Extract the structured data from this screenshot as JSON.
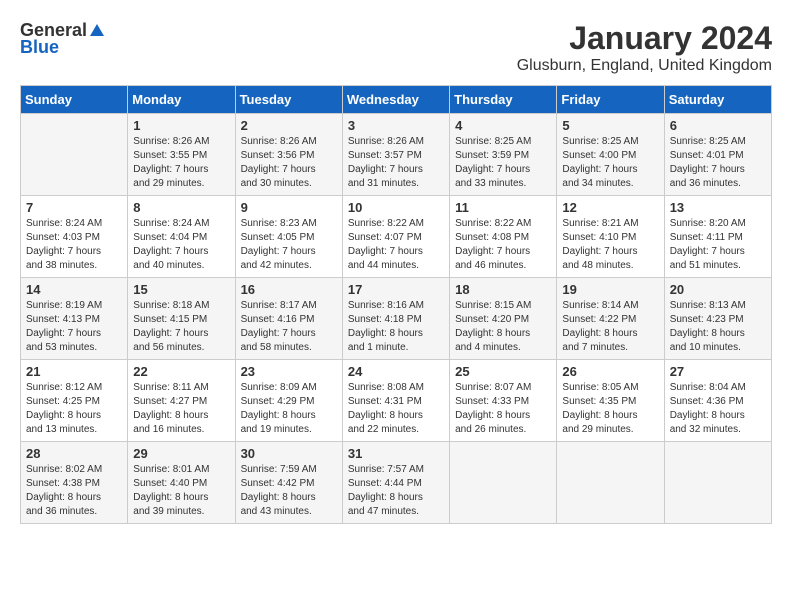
{
  "logo": {
    "general": "General",
    "blue": "Blue"
  },
  "title": "January 2024",
  "subtitle": "Glusburn, England, United Kingdom",
  "days_header": [
    "Sunday",
    "Monday",
    "Tuesday",
    "Wednesday",
    "Thursday",
    "Friday",
    "Saturday"
  ],
  "weeks": [
    [
      {
        "day": "",
        "info": ""
      },
      {
        "day": "1",
        "info": "Sunrise: 8:26 AM\nSunset: 3:55 PM\nDaylight: 7 hours\nand 29 minutes."
      },
      {
        "day": "2",
        "info": "Sunrise: 8:26 AM\nSunset: 3:56 PM\nDaylight: 7 hours\nand 30 minutes."
      },
      {
        "day": "3",
        "info": "Sunrise: 8:26 AM\nSunset: 3:57 PM\nDaylight: 7 hours\nand 31 minutes."
      },
      {
        "day": "4",
        "info": "Sunrise: 8:25 AM\nSunset: 3:59 PM\nDaylight: 7 hours\nand 33 minutes."
      },
      {
        "day": "5",
        "info": "Sunrise: 8:25 AM\nSunset: 4:00 PM\nDaylight: 7 hours\nand 34 minutes."
      },
      {
        "day": "6",
        "info": "Sunrise: 8:25 AM\nSunset: 4:01 PM\nDaylight: 7 hours\nand 36 minutes."
      }
    ],
    [
      {
        "day": "7",
        "info": "Sunrise: 8:24 AM\nSunset: 4:03 PM\nDaylight: 7 hours\nand 38 minutes."
      },
      {
        "day": "8",
        "info": "Sunrise: 8:24 AM\nSunset: 4:04 PM\nDaylight: 7 hours\nand 40 minutes."
      },
      {
        "day": "9",
        "info": "Sunrise: 8:23 AM\nSunset: 4:05 PM\nDaylight: 7 hours\nand 42 minutes."
      },
      {
        "day": "10",
        "info": "Sunrise: 8:22 AM\nSunset: 4:07 PM\nDaylight: 7 hours\nand 44 minutes."
      },
      {
        "day": "11",
        "info": "Sunrise: 8:22 AM\nSunset: 4:08 PM\nDaylight: 7 hours\nand 46 minutes."
      },
      {
        "day": "12",
        "info": "Sunrise: 8:21 AM\nSunset: 4:10 PM\nDaylight: 7 hours\nand 48 minutes."
      },
      {
        "day": "13",
        "info": "Sunrise: 8:20 AM\nSunset: 4:11 PM\nDaylight: 7 hours\nand 51 minutes."
      }
    ],
    [
      {
        "day": "14",
        "info": "Sunrise: 8:19 AM\nSunset: 4:13 PM\nDaylight: 7 hours\nand 53 minutes."
      },
      {
        "day": "15",
        "info": "Sunrise: 8:18 AM\nSunset: 4:15 PM\nDaylight: 7 hours\nand 56 minutes."
      },
      {
        "day": "16",
        "info": "Sunrise: 8:17 AM\nSunset: 4:16 PM\nDaylight: 7 hours\nand 58 minutes."
      },
      {
        "day": "17",
        "info": "Sunrise: 8:16 AM\nSunset: 4:18 PM\nDaylight: 8 hours\nand 1 minute."
      },
      {
        "day": "18",
        "info": "Sunrise: 8:15 AM\nSunset: 4:20 PM\nDaylight: 8 hours\nand 4 minutes."
      },
      {
        "day": "19",
        "info": "Sunrise: 8:14 AM\nSunset: 4:22 PM\nDaylight: 8 hours\nand 7 minutes."
      },
      {
        "day": "20",
        "info": "Sunrise: 8:13 AM\nSunset: 4:23 PM\nDaylight: 8 hours\nand 10 minutes."
      }
    ],
    [
      {
        "day": "21",
        "info": "Sunrise: 8:12 AM\nSunset: 4:25 PM\nDaylight: 8 hours\nand 13 minutes."
      },
      {
        "day": "22",
        "info": "Sunrise: 8:11 AM\nSunset: 4:27 PM\nDaylight: 8 hours\nand 16 minutes."
      },
      {
        "day": "23",
        "info": "Sunrise: 8:09 AM\nSunset: 4:29 PM\nDaylight: 8 hours\nand 19 minutes."
      },
      {
        "day": "24",
        "info": "Sunrise: 8:08 AM\nSunset: 4:31 PM\nDaylight: 8 hours\nand 22 minutes."
      },
      {
        "day": "25",
        "info": "Sunrise: 8:07 AM\nSunset: 4:33 PM\nDaylight: 8 hours\nand 26 minutes."
      },
      {
        "day": "26",
        "info": "Sunrise: 8:05 AM\nSunset: 4:35 PM\nDaylight: 8 hours\nand 29 minutes."
      },
      {
        "day": "27",
        "info": "Sunrise: 8:04 AM\nSunset: 4:36 PM\nDaylight: 8 hours\nand 32 minutes."
      }
    ],
    [
      {
        "day": "28",
        "info": "Sunrise: 8:02 AM\nSunset: 4:38 PM\nDaylight: 8 hours\nand 36 minutes."
      },
      {
        "day": "29",
        "info": "Sunrise: 8:01 AM\nSunset: 4:40 PM\nDaylight: 8 hours\nand 39 minutes."
      },
      {
        "day": "30",
        "info": "Sunrise: 7:59 AM\nSunset: 4:42 PM\nDaylight: 8 hours\nand 43 minutes."
      },
      {
        "day": "31",
        "info": "Sunrise: 7:57 AM\nSunset: 4:44 PM\nDaylight: 8 hours\nand 47 minutes."
      },
      {
        "day": "",
        "info": ""
      },
      {
        "day": "",
        "info": ""
      },
      {
        "day": "",
        "info": ""
      }
    ]
  ]
}
